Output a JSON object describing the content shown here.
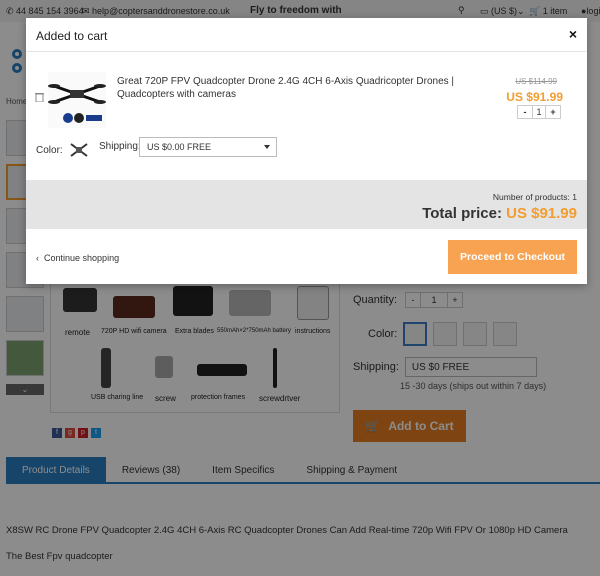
{
  "topbar": {
    "phone": "44 845 154 3964",
    "email": "help@coptersanddronestore.co.uk",
    "slogan": "Fly to freedom with",
    "currency": "(US $)",
    "cart": "1 item",
    "login": "logi"
  },
  "page": {
    "breadcrumb": "Home",
    "image_labels": {
      "remote": "remote",
      "camera": "720P HD wifi camera",
      "blades": "Extra blades",
      "battery": "550mAh×2*750mAh battery",
      "instructions": "instructions",
      "usb": "USB charing line",
      "screw": "screw",
      "frames": "protection frames",
      "screwdriver": "screwdrtver"
    },
    "quantity_label": "Quantity:",
    "quantity_value": "1",
    "color_label": "Color:",
    "shipping_label": "Shipping:",
    "shipping_value": "US $0 FREE",
    "shipping_note": "15 -30 days (ships out within 7 days)",
    "add_to_cart": "Add to Cart",
    "tabs": [
      {
        "label": "Product Details"
      },
      {
        "label": "Reviews (38)"
      },
      {
        "label": "Item Specifics"
      },
      {
        "label": "Shipping & Payment"
      }
    ],
    "description_line1": "X8SW RC Drone FPV Quadcopter  2.4G 4CH 6-Axis RC Quadcopter Drones Can Add Real-time 720p Wifi FPV Or 1080p HD Camera",
    "description_line2": "The Best Fpv quadcopter"
  },
  "modal": {
    "title": "Added to cart",
    "close": "×",
    "product_title": "Great 720P FPV Quadcopter Drone 2.4G 4CH 6-Axis Quadricopter Drones | Quadcopters with cameras",
    "old_price": "US $114.99",
    "new_price": "US $91.99",
    "qty": "1",
    "color_label": "Color:",
    "shipping_label": "Shipping:",
    "shipping_value": "US $0.00 FREE",
    "num_products": "Number of products: 1",
    "total_label": "Total price:",
    "total_value": "US $91.99",
    "continue": "Continue shopping",
    "checkout": "Proceed to Checkout"
  },
  "colors": {
    "accent": "#f39c2f",
    "checkout": "#f7a352",
    "tab": "#2a7fc1"
  }
}
